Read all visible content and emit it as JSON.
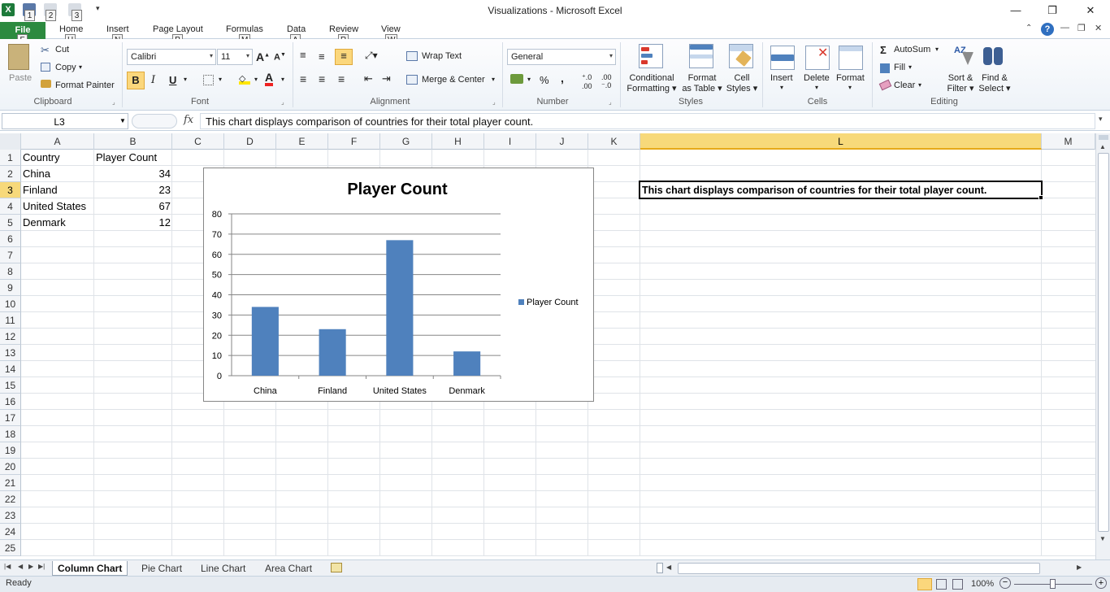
{
  "window": {
    "title": "Visualizations  -  Microsoft Excel",
    "minimize": "—",
    "restore": "❐",
    "close": "✕"
  },
  "qat": {
    "keytips": [
      "1",
      "2",
      "3"
    ]
  },
  "tabs": [
    {
      "label": "File",
      "keytip": "F"
    },
    {
      "label": "Home",
      "keytip": "H"
    },
    {
      "label": "Insert",
      "keytip": "N"
    },
    {
      "label": "Page Layout",
      "keytip": "P"
    },
    {
      "label": "Formulas",
      "keytip": "M"
    },
    {
      "label": "Data",
      "keytip": "A"
    },
    {
      "label": "Review",
      "keytip": "R"
    },
    {
      "label": "View",
      "keytip": "W"
    }
  ],
  "ribbon": {
    "clipboard": {
      "label": "Clipboard",
      "paste": "Paste",
      "cut": "Cut",
      "copy": "Copy",
      "format_painter": "Format Painter"
    },
    "font": {
      "label": "Font",
      "font_name": "Calibri",
      "font_size": "11",
      "bold": "B",
      "italic": "I",
      "underline": "U"
    },
    "alignment": {
      "label": "Alignment",
      "wrap_text": "Wrap Text",
      "merge_center": "Merge & Center"
    },
    "number": {
      "label": "Number",
      "format": "General",
      "percent": "%",
      "comma": ","
    },
    "styles": {
      "label": "Styles",
      "conditional_line1": "Conditional",
      "conditional_line2": "Formatting",
      "format_table_line1": "Format",
      "format_table_line2": "as Table",
      "cell_styles_line1": "Cell",
      "cell_styles_line2": "Styles"
    },
    "cells": {
      "label": "Cells",
      "insert": "Insert",
      "delete": "Delete",
      "format": "Format"
    },
    "editing": {
      "label": "Editing",
      "autosum": "AutoSum",
      "fill": "Fill",
      "clear": "Clear",
      "sort_line1": "Sort &",
      "sort_line2": "Filter",
      "find_line1": "Find &",
      "find_line2": "Select"
    }
  },
  "formula_bar": {
    "name_box": "L3",
    "fx": "fx",
    "content": "This chart displays comparison of countries for their total player count."
  },
  "columns": [
    "A",
    "B",
    "C",
    "D",
    "E",
    "F",
    "G",
    "H",
    "I",
    "J",
    "K",
    "L",
    "M"
  ],
  "rows": [
    "1",
    "2",
    "3",
    "4",
    "5",
    "6",
    "7",
    "8",
    "9",
    "10",
    "11",
    "12",
    "13",
    "14",
    "15",
    "16",
    "17",
    "18",
    "19",
    "20",
    "21",
    "22",
    "23",
    "24",
    "25"
  ],
  "cells": {
    "A1": "Country",
    "B1": "Player Count",
    "A2": "China",
    "B2": "34",
    "A3": "Finland",
    "B3": "23",
    "A4": "United States",
    "B4": "67",
    "A5": "Denmark",
    "B5": "12",
    "L3": "This chart displays comparison of countries for their total player count."
  },
  "chart_data": {
    "type": "bar",
    "title": "Player Count",
    "categories": [
      "China",
      "Finland",
      "United States",
      "Denmark"
    ],
    "series": [
      {
        "name": "Player Count",
        "values": [
          34,
          23,
          67,
          12
        ],
        "color": "#4f81bd"
      }
    ],
    "ylim": [
      0,
      80
    ],
    "yticks": [
      "0",
      "10",
      "20",
      "30",
      "40",
      "50",
      "60",
      "70",
      "80"
    ],
    "grid": true,
    "legend": "right"
  },
  "sheet_tabs": [
    "Column Chart",
    "Pie Chart",
    "Line Chart",
    "Area Chart"
  ],
  "active_sheet": "Column Chart",
  "status": {
    "ready": "Ready",
    "zoom": "100%"
  },
  "colors": {
    "accent": "#2c8a3f",
    "selection_header": "#f7d97a",
    "bar": "#4f81bd"
  }
}
